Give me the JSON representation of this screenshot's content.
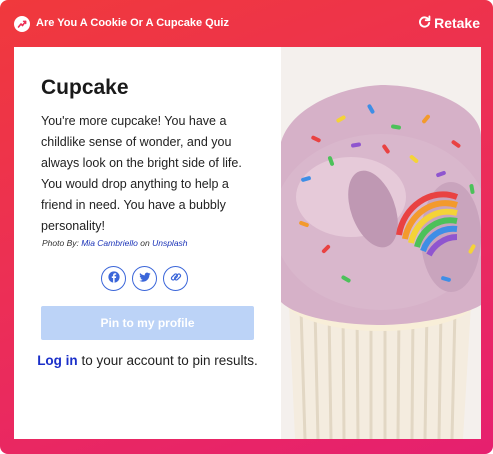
{
  "header": {
    "quiz_title": "Are You A Cookie Or A Cupcake Quiz",
    "retake_label": "Retake"
  },
  "result": {
    "title": "Cupcake",
    "description": "You're more cupcake! You have a childlike sense of wonder, and you always look on the bright side of life. You would drop anything to help a friend in need. You have a bubbly personality!",
    "photo_credit_prefix": "Photo By: ",
    "photographer": "Mia Cambriello",
    "credit_on": " on ",
    "source": "Unsplash",
    "image_icon": "cupcake-photo"
  },
  "share": {
    "icons": [
      "facebook-icon",
      "twitter-icon",
      "link-icon"
    ]
  },
  "pin_button_label": "Pin to my profile",
  "login": {
    "link_label": "Log in",
    "rest_text": " to your account to pin results."
  },
  "colors": {
    "gradient_start": "#f0393c",
    "gradient_end": "#e6206f",
    "accent_blue": "#3b66d9",
    "pin_button_bg": "#bcd3f7",
    "link_blue": "#1a2fc9"
  }
}
